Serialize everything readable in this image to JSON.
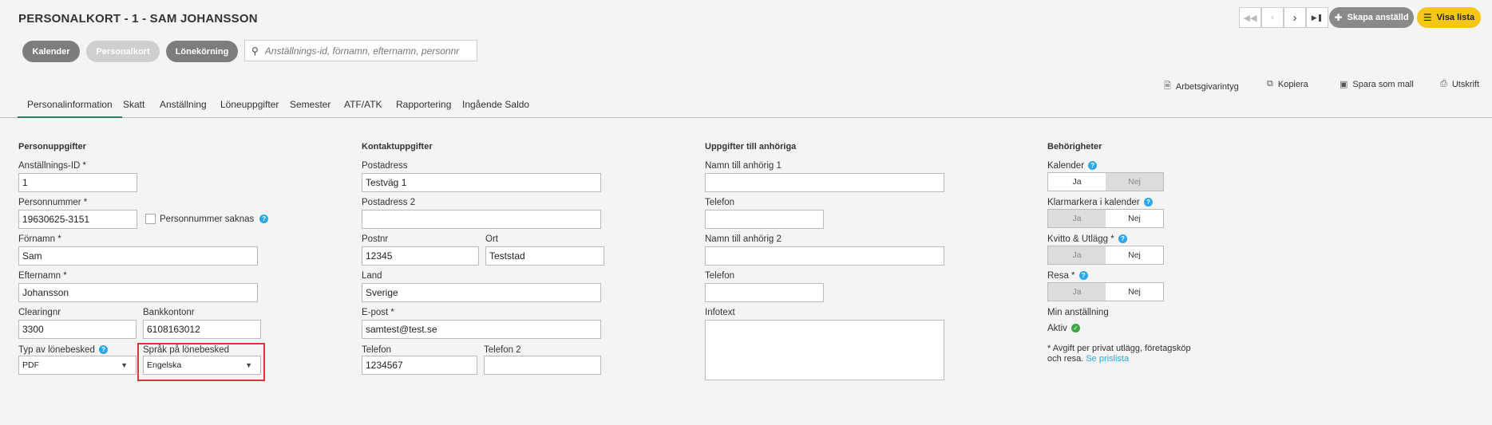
{
  "header": {
    "title": "PERSONALKORT - 1 - SAM JOHANSSON",
    "create_button": "Skapa anställd",
    "list_button": "Visa lista"
  },
  "segments": [
    {
      "label": "Kalender"
    },
    {
      "label": "Personalkort"
    },
    {
      "label": "Lönekörning"
    }
  ],
  "search": {
    "placeholder": "Anställnings-id, förnamn, efternamn, personnr"
  },
  "actions": {
    "certificate": "Arbetsgivarintyg",
    "copy": "Kopiera",
    "save_template": "Spara som mall",
    "print": "Utskrift"
  },
  "tabs": [
    "Personalinformation",
    "Skatt",
    "Anställning",
    "Löneuppgifter",
    "Semester",
    "ATF/ATK",
    "Rapportering",
    "Ingående Saldo"
  ],
  "personal": {
    "heading": "Personuppgifter",
    "employee_id_label": "Anställnings-ID *",
    "employee_id": "1",
    "ssn_label": "Personnummer *",
    "ssn": "19630625-3151",
    "ssn_missing_label": "Personnummer saknas",
    "first_name_label": "Förnamn *",
    "first_name": "Sam",
    "last_name_label": "Efternamn *",
    "last_name": "Johansson",
    "clearing_label": "Clearingnr",
    "clearing": "3300",
    "account_label": "Bankkontonr",
    "account": "6108163012",
    "payslip_type_label": "Typ av lönebesked",
    "payslip_type": "PDF",
    "payslip_lang_label": "Språk på lönebesked",
    "payslip_lang": "Engelska"
  },
  "contact": {
    "heading": "Kontaktuppgifter",
    "address_label": "Postadress",
    "address": "Testväg 1",
    "address2_label": "Postadress 2",
    "address2": "",
    "zip_label": "Postnr",
    "zip": "12345",
    "city_label": "Ort",
    "city": "Teststad",
    "country_label": "Land",
    "country": "Sverige",
    "email_label": "E-post *",
    "email": "samtest@test.se",
    "phone_label": "Telefon",
    "phone": "1234567",
    "phone2_label": "Telefon 2",
    "phone2": ""
  },
  "relatives": {
    "heading": "Uppgifter till anhöriga",
    "name1_label": "Namn till anhörig 1",
    "phone1_label": "Telefon",
    "name2_label": "Namn till anhörig 2",
    "phone2_label": "Telefon",
    "info_label": "Infotext"
  },
  "permissions": {
    "heading": "Behörigheter",
    "yes": "Ja",
    "no": "Nej",
    "calendar_label": "Kalender",
    "mark_calendar_label": "Klarmarkera i kalender",
    "receipts_label": "Kvitto & Utlägg *",
    "travel_label": "Resa *",
    "my_employment_label": "Min anställning",
    "status": "Aktiv",
    "note": "* Avgift per privat utlägg, företagsköp och resa.",
    "note_link": "Se prislista"
  }
}
